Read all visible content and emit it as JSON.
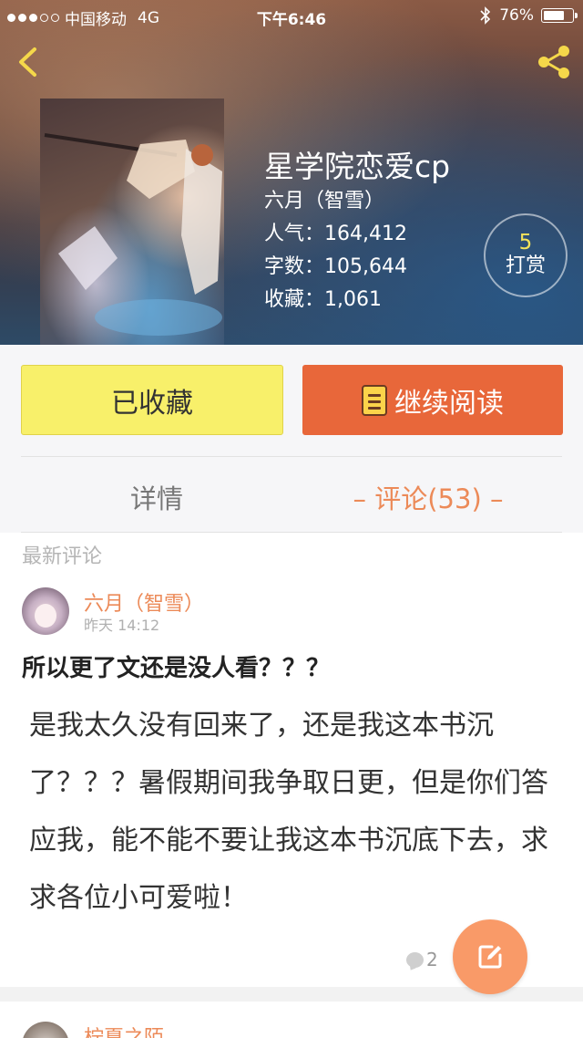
{
  "status_bar": {
    "carrier": "中国移动",
    "network": "4G",
    "time": "下午6:46",
    "battery_percent": "76%",
    "battery_level": 0.76
  },
  "header": {
    "back_icon": "chevron-left-icon",
    "share_icon": "share-icon"
  },
  "book": {
    "title": "星学院恋爱cp",
    "author": "六月（智雪）",
    "popularity": "人气：164,412",
    "word_count": "字数：105,644",
    "favorites": "收藏：1,061",
    "tip_count": "5",
    "tip_label": "打赏"
  },
  "actions": {
    "favorited_label": "已收藏",
    "continue_label": "继续阅读",
    "accent_yellow": "#f8f06a",
    "accent_orange": "#e8673a"
  },
  "tabs": {
    "details": "详情",
    "comments": "– 评论(53) –"
  },
  "comments": {
    "section_label": "最新评论",
    "items": [
      {
        "author": "六月（智雪）",
        "time": "昨天 14:12",
        "title": "所以更了文还是没人看？？？",
        "body": "是我太久没有回来了，还是我这本书沉了？？？暑假期间我争取日更，但是你们答应我，能不能不要让我这本书沉底下去，求求各位小可爱啦！",
        "reply_count": "2"
      },
      {
        "author": "柠夏之陌"
      }
    ]
  },
  "fab": {
    "icon": "edit-icon"
  }
}
